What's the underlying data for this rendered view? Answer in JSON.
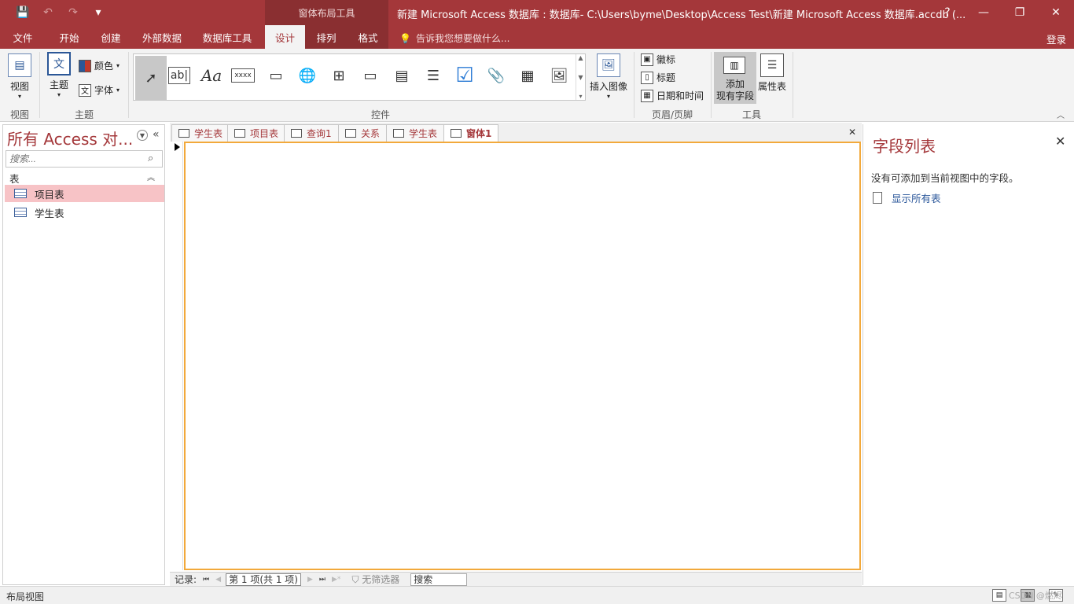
{
  "window": {
    "context_tools": "窗体布局工具",
    "title": "新建 Microsoft Access 数据库 : 数据库- C:\\Users\\byme\\Desktop\\Access Test\\新建 Microsoft Access 数据库.accdb (...",
    "help": "?",
    "minimize": "—",
    "restore": "❐",
    "close": "✕"
  },
  "qat": {
    "save": "💾",
    "undo": "↶",
    "redo": "↷",
    "customize": "▾"
  },
  "tabs": [
    {
      "label": "文件"
    },
    {
      "label": "开始"
    },
    {
      "label": "创建"
    },
    {
      "label": "外部数据"
    },
    {
      "label": "数据库工具"
    },
    {
      "label": "设计"
    },
    {
      "label": "排列"
    },
    {
      "label": "格式"
    }
  ],
  "tell_me": "告诉我您想要做什么...",
  "login": "登录",
  "ribbon": {
    "view_btn": "视图",
    "view_group": "视图",
    "theme_btn": "主题",
    "color_btn": "颜色",
    "font_btn": "字体",
    "theme_group": "主题",
    "controls_group": "控件",
    "insert_image": "插入图像",
    "logo": "徽标",
    "title": "标题",
    "datetime": "日期和时间",
    "header_footer_group": "页眉/页脚",
    "add_fields_line1": "添加",
    "add_fields_line2": "现有字段",
    "property_sheet": "属性表",
    "tools_group": "工具",
    "textbox_glyph": "ab|",
    "label_glyph": "Aa",
    "xxxx_glyph": "xxxx"
  },
  "nav": {
    "title": "所有 Access 对...",
    "search_placeholder": "搜索...",
    "group": "表",
    "items": [
      {
        "label": "项目表"
      },
      {
        "label": "学生表"
      }
    ]
  },
  "doc_tabs": [
    {
      "label": "学生表"
    },
    {
      "label": "项目表"
    },
    {
      "label": "查询1"
    },
    {
      "label": "关系"
    },
    {
      "label": "学生表"
    },
    {
      "label": "窗体1"
    }
  ],
  "record_nav": {
    "label": "记录:",
    "position": "第 1 项(共 1 项)",
    "no_filter": "无筛选器",
    "search": "搜索"
  },
  "field_list": {
    "title": "字段列表",
    "message": "没有可添加到当前视图中的字段。",
    "show_all": "显示所有表"
  },
  "status": {
    "text": "布局视图",
    "watermark": "CSDN @燃烬"
  },
  "colors": {
    "accent": "#a4373a",
    "selection": "#f7c3c6",
    "form_border": "#f2a93b"
  }
}
